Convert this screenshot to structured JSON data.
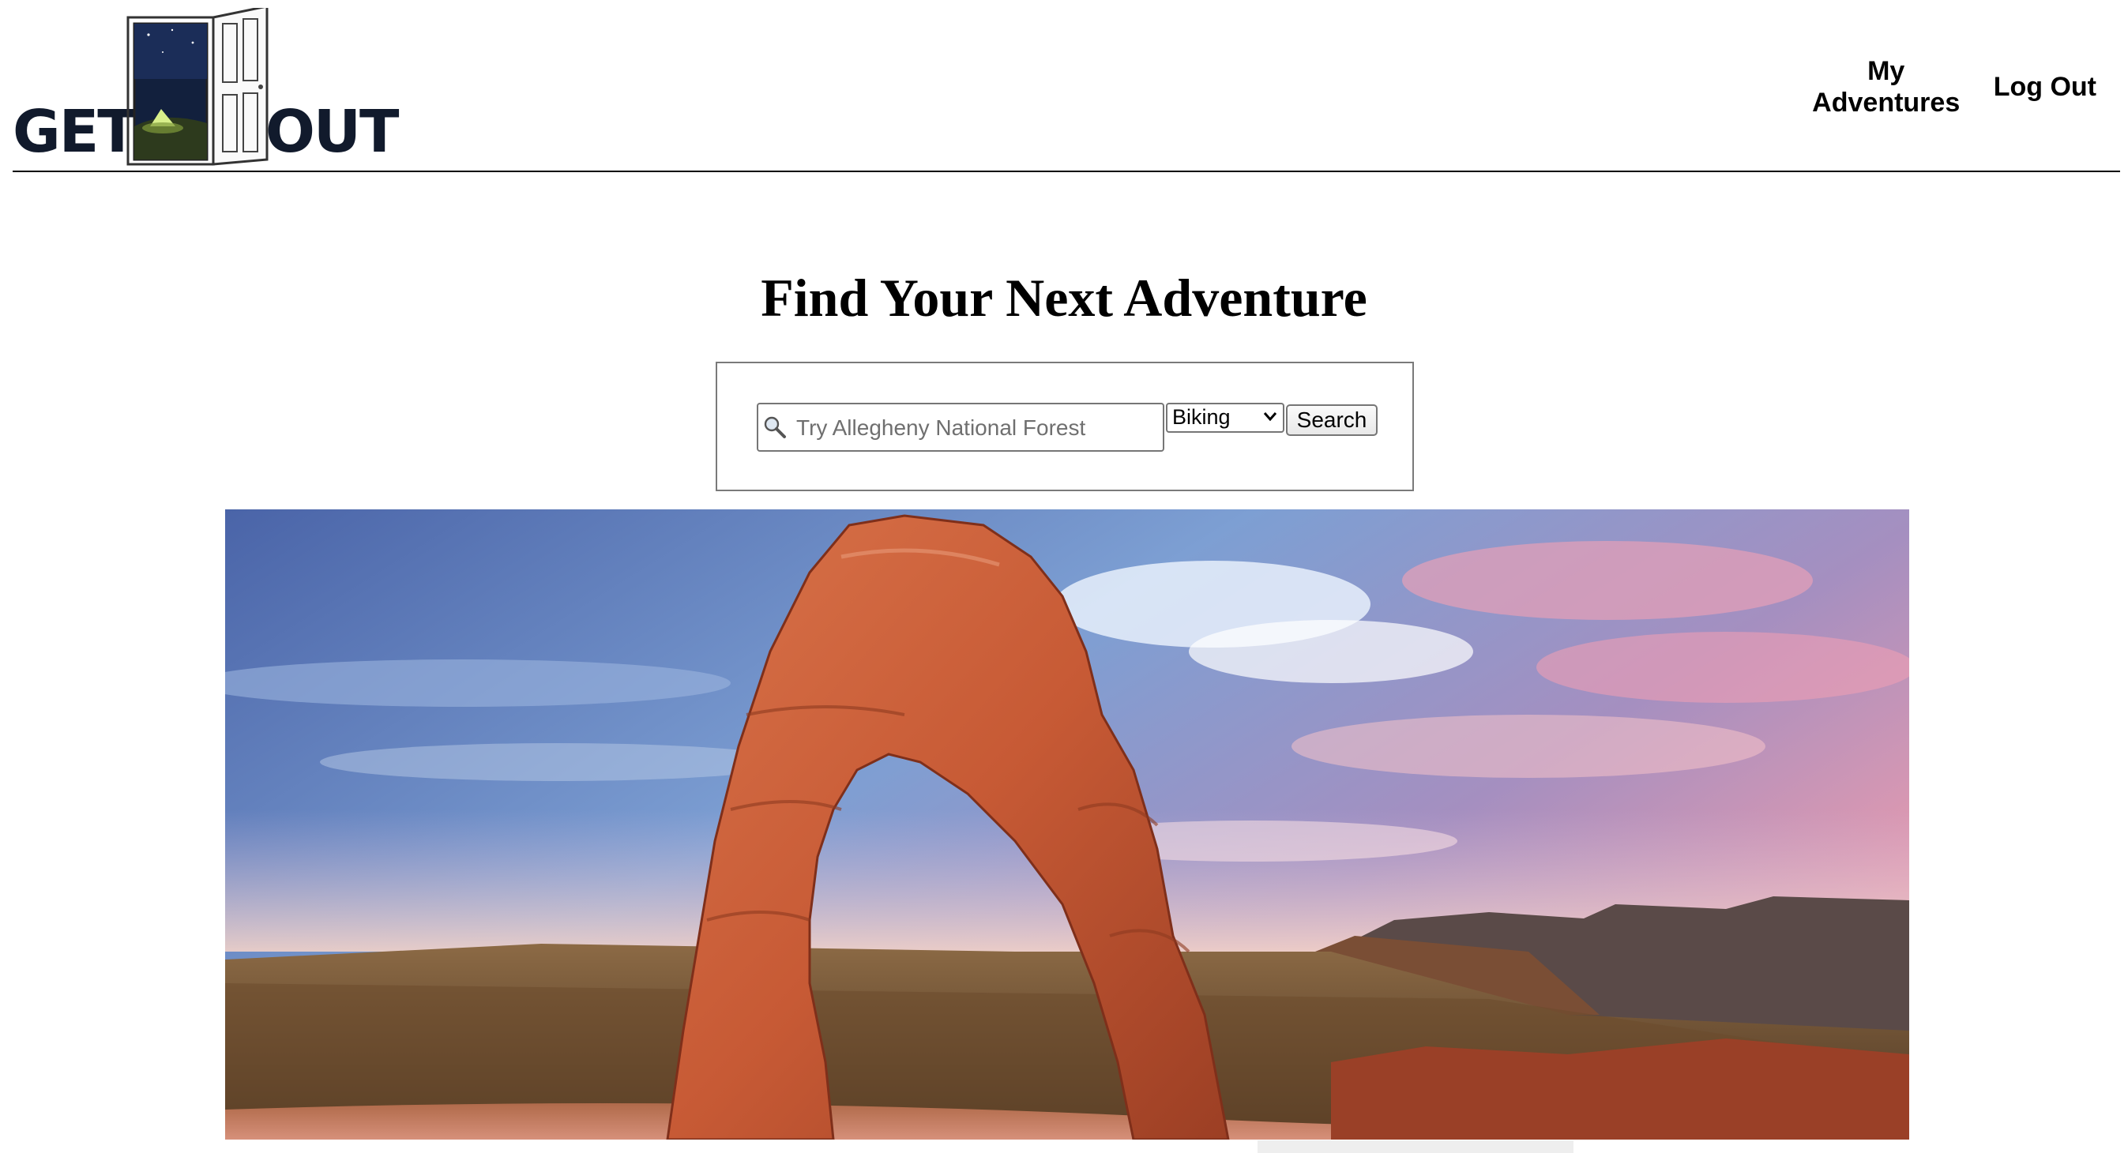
{
  "header": {
    "logo": {
      "word_left": "GET",
      "word_right": "OUT",
      "icon": "open-door-icon",
      "color": "#111a2c"
    },
    "nav": [
      {
        "label": "My Adventures"
      },
      {
        "label": "Log Out"
      }
    ]
  },
  "main": {
    "title": "Find Your Next Adventure",
    "search": {
      "placeholder": "Try Allegheny National Forest",
      "value": "",
      "icon": "magnifier-icon",
      "activity": {
        "selected": "Biking"
      },
      "button_label": "Search"
    },
    "hero": {
      "icon": "delicate-arch-photo",
      "colors": {
        "sky": "#5f7fc0",
        "clouds": "#e9a6b8",
        "rock": "#c75a35"
      }
    }
  }
}
